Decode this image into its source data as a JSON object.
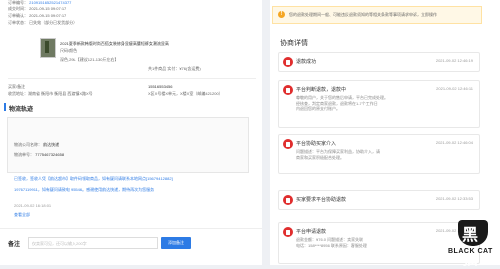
{
  "order": {
    "order_no_label": "订单编号：",
    "order_no": "2109151652521474377",
    "created_label": "成交时间：",
    "created": "2021-09-15 09:07:17",
    "paid_label": "订单确认：",
    "paid": "2021-09-15 09:07:17",
    "status_label": "订单状态：",
    "status": "已失效（部分已发货部分）",
    "product_title": "2021夏季新款韩版时尚百搭女装修身显瘦高腰短裤女潮流显高",
    "product_spec": "尺码/颜色",
    "product_color": "深色,29L【建议121-130斤左右】",
    "product_price": "共1件商品   实付：¥76(含运费)",
    "buyer_label": "买家/备注",
    "buyer_phone": "15516553456",
    "address": "收货地址：湖南省 衡阳市 衡阳县 西渡镇X路X号",
    "address_detail": "X区X号楼X单元，X楼X室（邮编421200）"
  },
  "logistics": {
    "title": "物流轨迹",
    "company_label": "物流公司名称：",
    "company": "韵达快递",
    "tracking_label": "物流单号：",
    "tracking": "7775467324658",
    "event1": "已签收，签收人凭【韵达超市】取件码领取商品，如有疑问请联系本地网点[15679412882]",
    "event1_detail": "19767119911，如有疑问请致电 95546。感谢使用韵达快递，期待再次为您服务",
    "event_time": "2021-09-02 16:18:01",
    "more": "查看全部"
  },
  "notes": {
    "label": "备注",
    "placeholder": "仅卖家可见，还可以输入200字",
    "button": "添加备注"
  },
  "notice": {
    "text": "您的退款处理期间一般、可能违反退款须知的等相关条款等事项请求申诉，立即操作",
    "link": "立即操作"
  },
  "negotiation": {
    "title": "协商详情",
    "records": [
      {
        "title": "退款成功",
        "time": "2021-09-02 12:46:19",
        "body": []
      },
      {
        "title": "平台判断退款，退款中",
        "time": "2021-09-02 12:46:11",
        "body": [
          "尊敬的用户，关于您的售后申请，平台已完成处理。",
          "经核查，判定商家退款，退款将在1-7个工作日",
          "内退回您的原支付账户。"
        ]
      },
      {
        "title": "平台协助买家介入",
        "time": "2021-09-02 12:46:04",
        "body": [
          "问题描述：平台为保障买家利益，协助介入，请",
          "商家和买家积极配合处理。"
        ]
      },
      {
        "title": "买家要求平台协助退款",
        "time": "2021-09-02 12:33:53",
        "body": []
      },
      {
        "title": "平台申请退款",
        "time": "2021-09-02 12:46:19",
        "body": [
          "退款金额：¥76.0 问题描述：卖家失联",
          "电话：158****8956 联系原因：客服处理"
        ]
      }
    ]
  },
  "watermark": {
    "cn": "黑猫",
    "en": "BLACK CAT"
  },
  "colors": {
    "accent": "#2d7be5",
    "alert": "#e02e2e",
    "warn_bg": "#fff8e6"
  }
}
